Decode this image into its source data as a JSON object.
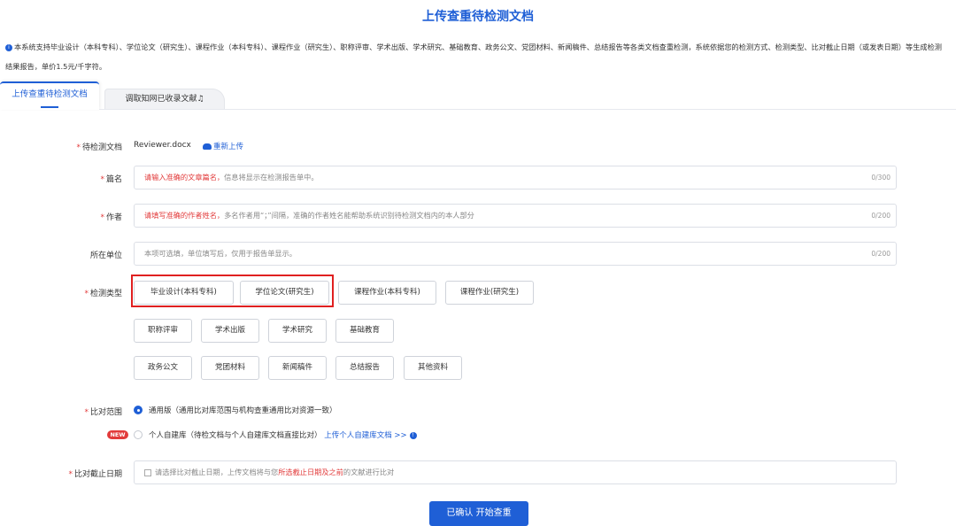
{
  "title": "上传查重待检测文档",
  "notice": {
    "text": "本系统支持毕业设计（本科专科）、学位论文（研究生）、课程作业（本科专科）、课程作业（研究生）、职称评审、学术出版、学术研究、基础教育、政务公文、党团材料、新闻稿件、总结报告等各类文档查重检测，系统依据您的检测方式、检测类型、比对截止日期（或发表日期）等生成检测结果报告，单价1.5元/千字符。"
  },
  "tabs": {
    "active": "上传查重待检测文档",
    "inactive": "调取知网已收录文献"
  },
  "form": {
    "file": {
      "label": "待检测文档",
      "filename": "Reviewer.docx",
      "reupload": "重新上传"
    },
    "title_field": {
      "label": "篇名",
      "placeholder_hl": "请输入准确的文章篇名，",
      "placeholder_rest": "信息将显示在检测报告单中。",
      "count": "0/300"
    },
    "author_field": {
      "label": "作者",
      "placeholder_hl": "请填写准确的作者姓名，",
      "placeholder_rest": "多名作者用“；”间隔，准确的作者姓名能帮助系统识别待检测文档内的本人部分",
      "count": "0/200"
    },
    "unit_field": {
      "label": "所在单位",
      "placeholder": "本项可选填，单位填写后，仅用于报告单显示。",
      "count": "0/200"
    },
    "type": {
      "label": "检测类型",
      "options": [
        "毕业设计(本科专科)",
        "学位论文(研究生)",
        "课程作业(本科专科)",
        "课程作业(研究生)",
        "职称评审",
        "学术出版",
        "学术研究",
        "基础教育",
        "政务公文",
        "党团材料",
        "新闻稿件",
        "总结报告",
        "其他资料"
      ]
    },
    "scope": {
      "label": "比对范围",
      "option1": "通用版（通用比对库范围与机构查重通用比对资源一致）",
      "badge": "NEW",
      "option2": "个人自建库（待检文档与个人自建库文档直接比对）",
      "option2_link": "上传个人自建库文档 >>"
    },
    "date": {
      "label": "比对截止日期",
      "placeholder_a": "请选择比对截止日期，上传文档将与您",
      "placeholder_hl": "所选截止日期及之前",
      "placeholder_b": "的文献进行比对"
    }
  },
  "submit": "已确认 开始查重",
  "colors": {
    "primary": "#1f5fd6",
    "required": "#e23b3b",
    "highlight_box": "#e02020"
  }
}
